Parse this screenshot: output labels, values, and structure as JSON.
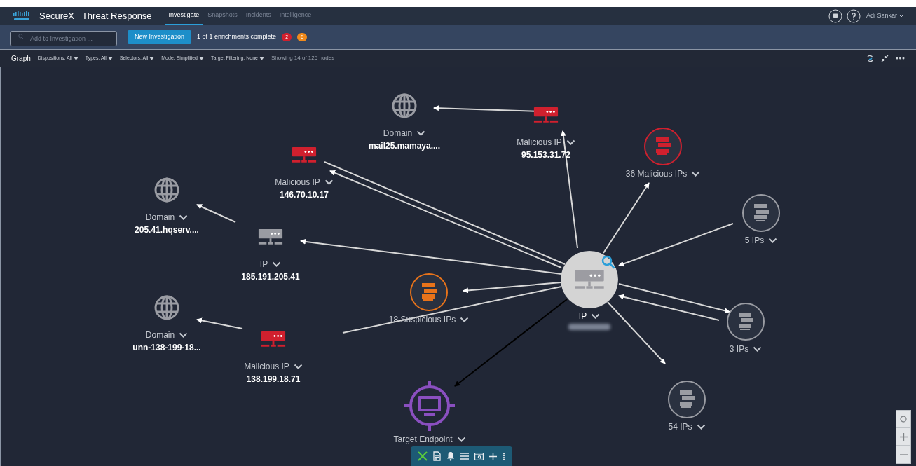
{
  "app": {
    "title": "SecureX",
    "subtitle": "Threat Response"
  },
  "nav_tabs": [
    {
      "label": "Investigate",
      "selected": true
    },
    {
      "label": "Snapshots",
      "selected": false
    },
    {
      "label": "Incidents",
      "selected": false
    },
    {
      "label": "Intelligence",
      "selected": false
    }
  ],
  "user": {
    "name": "Adi Sankar"
  },
  "toolbar": {
    "search": {
      "placeholder": "Add to Investigation ..."
    },
    "new_button": "New Investigation",
    "status": "1 of 1 enrichments complete",
    "badges": [
      {
        "count": "2",
        "color": "#d0202e"
      },
      {
        "count": "5",
        "color": "#f08a1c"
      }
    ]
  },
  "graph_bar": {
    "title": "Graph",
    "filters": [
      "Dispositions: All",
      "Types: All",
      "Selectors: All",
      "Mode: Simplified",
      "Target Filtering: None"
    ],
    "summary": "Showing 14 of 125 nodes"
  },
  "nodes": [
    {
      "kind": "domain",
      "label": "Domain",
      "value": "mail25.mamaya...."
    },
    {
      "kind": "ip",
      "color": "#d0202e",
      "label": "Malicious IP",
      "value": "95.153.31.72"
    },
    {
      "kind": "group",
      "color": "#d0202e",
      "label": "36 Malicious IPs"
    },
    {
      "kind": "ip",
      "color": "#d0202e",
      "label": "Malicious IP",
      "value": "146.70.10.17"
    },
    {
      "kind": "domain",
      "label": "Domain",
      "value": "205.41.hqserv...."
    },
    {
      "kind": "group",
      "color": "#9a9ca3",
      "label": "5 IPs"
    },
    {
      "kind": "ip",
      "color": "#9a9ca3",
      "label": "IP",
      "value": "185.191.205.41"
    },
    {
      "kind": "focus",
      "label": "IP"
    },
    {
      "kind": "group",
      "color": "#e8731a",
      "label": "18 Suspicious IPs"
    },
    {
      "kind": "domain",
      "label": "Domain",
      "value": "unn-138-199-18..."
    },
    {
      "kind": "group",
      "color": "#9a9ca3",
      "label": "3 IPs"
    },
    {
      "kind": "ip",
      "color": "#d0202e",
      "label": "Malicious IP",
      "value": "138.199.18.71"
    },
    {
      "kind": "group",
      "color": "#9a9ca3",
      "label": "54 IPs"
    },
    {
      "kind": "endpoint",
      "label": "Target Endpoint"
    }
  ]
}
